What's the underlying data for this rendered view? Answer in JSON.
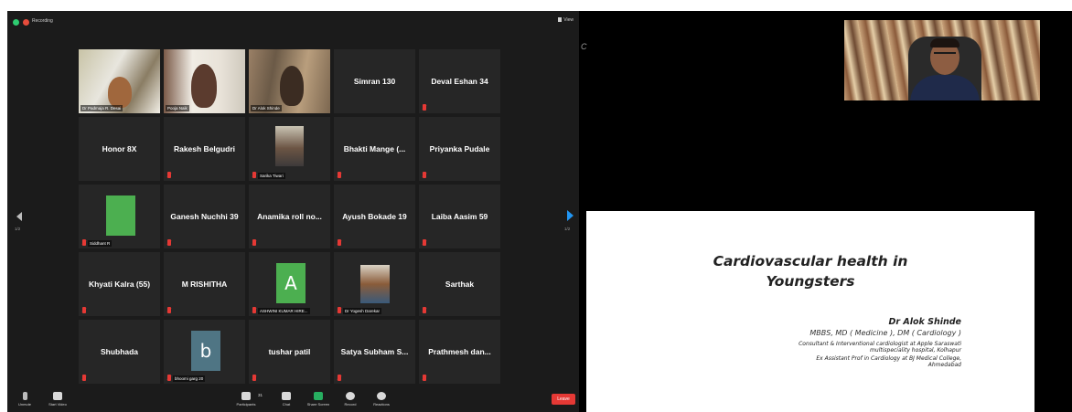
{
  "zoom": {
    "recording_label": "Recording",
    "view_label": "View",
    "page_left": "1/2",
    "page_right": "1/2",
    "tiles": [
      {
        "name": "",
        "tag": "Dr Padmaja R. Desai",
        "kind": "video1",
        "active": true,
        "muted": false
      },
      {
        "name": "",
        "tag": "Pooja Naik",
        "kind": "video2",
        "muted": false
      },
      {
        "name": "",
        "tag": "Dr Alok Shinde",
        "kind": "video3",
        "muted": false
      },
      {
        "name": "Simran 130",
        "tag": "",
        "muted": false
      },
      {
        "name": "Deval Eshan 34",
        "tag": "",
        "muted": true
      },
      {
        "name": "Honor 8X",
        "tag": "",
        "muted": false
      },
      {
        "name": "Rakesh Belgudri",
        "tag": "",
        "muted": true
      },
      {
        "name": "",
        "tag": "Sarika Tiwari",
        "kind": "photo",
        "muted": true
      },
      {
        "name": "Bhakti Mange (...",
        "tag": "",
        "muted": true
      },
      {
        "name": "Priyanka Pudale",
        "tag": "",
        "muted": true
      },
      {
        "name": "",
        "tag": "Siddhant R",
        "kind": "green-square",
        "muted": true
      },
      {
        "name": "Ganesh Nuchhi 39",
        "tag": "",
        "muted": true
      },
      {
        "name": "Anamika roll no...",
        "tag": "",
        "muted": true
      },
      {
        "name": "Ayush Bokade 19",
        "tag": "",
        "muted": true
      },
      {
        "name": "Laiba Aasim 59",
        "tag": "",
        "muted": true
      },
      {
        "name": "Khyati Kalra (55)",
        "tag": "",
        "muted": true
      },
      {
        "name": "M RISHITHA",
        "tag": "",
        "muted": true
      },
      {
        "name": "",
        "tag": "ASHWINI KUMAR HIRE...",
        "kind": "avatar",
        "letter": "A",
        "color": "#4caf50",
        "muted": true
      },
      {
        "name": "",
        "tag": "Dr Yogesh Darekar",
        "kind": "photo2",
        "muted": true
      },
      {
        "name": "Sarthak",
        "tag": "",
        "muted": true
      },
      {
        "name": "Shubhada",
        "tag": "",
        "muted": true
      },
      {
        "name": "",
        "tag": "bhoomi garg 20",
        "kind": "avatar",
        "letter": "b",
        "color": "#4f7584",
        "muted": true
      },
      {
        "name": "tushar patil",
        "tag": "",
        "muted": true
      },
      {
        "name": "Satya Subham S...",
        "tag": "",
        "muted": true
      },
      {
        "name": "Prathmesh dan...",
        "tag": "",
        "muted": true
      }
    ],
    "toolbar": {
      "unmute": "Unmute",
      "start_video": "Start Video",
      "participants": "Participants",
      "participants_count": "31",
      "chat": "Chat",
      "share_screen": "Share Screen",
      "record": "Record",
      "reactions": "Reactions",
      "leave": "Leave"
    }
  },
  "right": {
    "c_mark": "C",
    "slide": {
      "title_line1": "Cardiovascular health in",
      "title_line2": "Youngsters",
      "author": "Dr Alok Shinde",
      "degrees": "MBBS, MD ( Medicine ), DM ( Cardiology )",
      "line1": "Consultant & Interventional cardiologist at Apple Saraswati",
      "line2": "multispeciality hospital, Kolhapur",
      "line3": "Ex Assistant Prof in Cardiology at BJ Medical College,",
      "line4": "Ahmedabad"
    }
  }
}
